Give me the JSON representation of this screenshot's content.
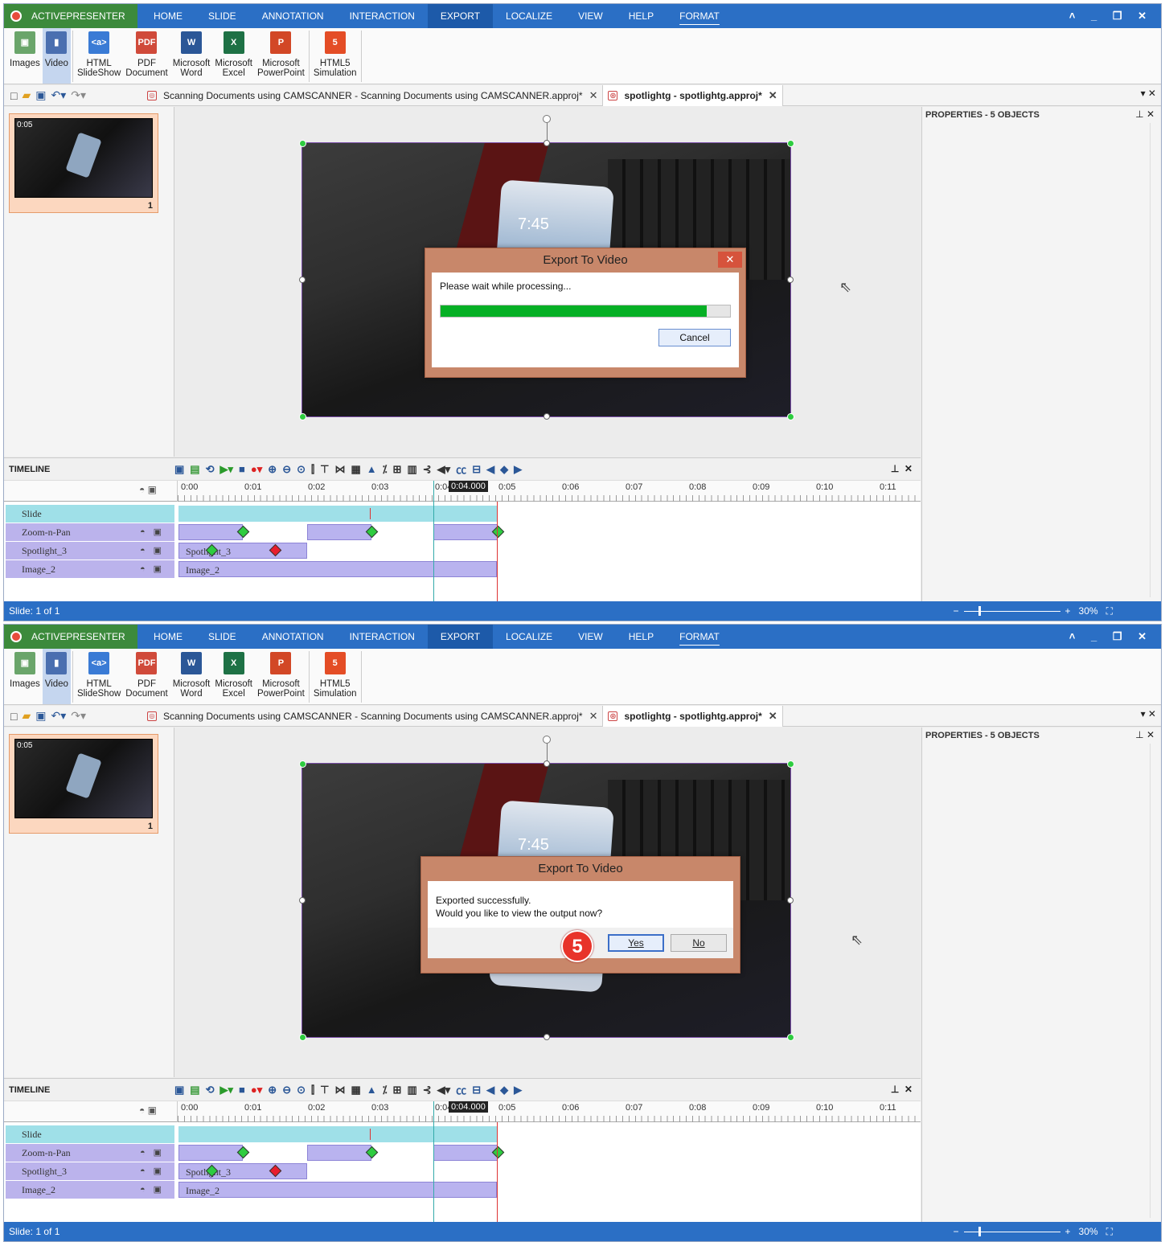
{
  "app": {
    "name": "ACTIVEPRESENTER",
    "menu": [
      "HOME",
      "SLIDE",
      "ANNOTATION",
      "INTERACTION",
      "EXPORT",
      "LOCALIZE",
      "VIEW",
      "HELP",
      "FORMAT"
    ],
    "active_menu": "EXPORT",
    "window_controls": "˄ _ ❐ ✕"
  },
  "ribbon": {
    "images": "Images",
    "video": "Video",
    "html_slideshow": [
      "HTML",
      "SlideShow"
    ],
    "pdf": [
      "PDF",
      "Document"
    ],
    "word": [
      "Microsoft",
      "Word"
    ],
    "excel": [
      "Microsoft",
      "Excel"
    ],
    "powerpoint": [
      "Microsoft",
      "PowerPoint"
    ],
    "html5": [
      "HTML5",
      "Simulation"
    ]
  },
  "tabs": [
    {
      "label": "Scanning Documents using CAMSCANNER - Scanning Documents using CAMSCANNER.approj*",
      "active": false
    },
    {
      "label": "spotlightg - spotlightg.approj*",
      "active": true
    }
  ],
  "thumbnail": {
    "time": "0:05",
    "number": "1"
  },
  "properties": {
    "title": "PROPERTIES - 5 OBJECTS"
  },
  "timeline": {
    "title": "TIMELINE",
    "ruler_ticks": [
      "0:00",
      "0:01",
      "0:02",
      "0:03",
      "0:04",
      "0:05",
      "0:06",
      "0:07",
      "0:08",
      "0:09",
      "0:10",
      "0:11"
    ],
    "current_time": "0:04.000",
    "rows": [
      {
        "label": "Slide"
      },
      {
        "label": "Zoom-n-Pan"
      },
      {
        "label": "Spotlight_3"
      },
      {
        "label": "Image_2"
      }
    ],
    "bar_labels": {
      "spotlight": "Spotlight_3",
      "image": "Image_2"
    }
  },
  "status": {
    "slide": "Slide: 1 of 1",
    "zoom": "30%"
  },
  "dialog1": {
    "title": "Export To Video",
    "message": "Please wait while processing...",
    "progress": 0.92,
    "cancel": "Cancel",
    "close": "✕"
  },
  "dialog2": {
    "title": "Export To Video",
    "line1": "Exported successfully.",
    "line2": "Would you like to view the output now?",
    "yes": "Yes",
    "no": "No",
    "step": "5"
  },
  "colors": {
    "titlebar": "#2b6fc5",
    "appname": "#3c8a3c",
    "progress": "#06b025",
    "dialog_frame": "#c8876a",
    "step_badge": "#e8332a"
  }
}
